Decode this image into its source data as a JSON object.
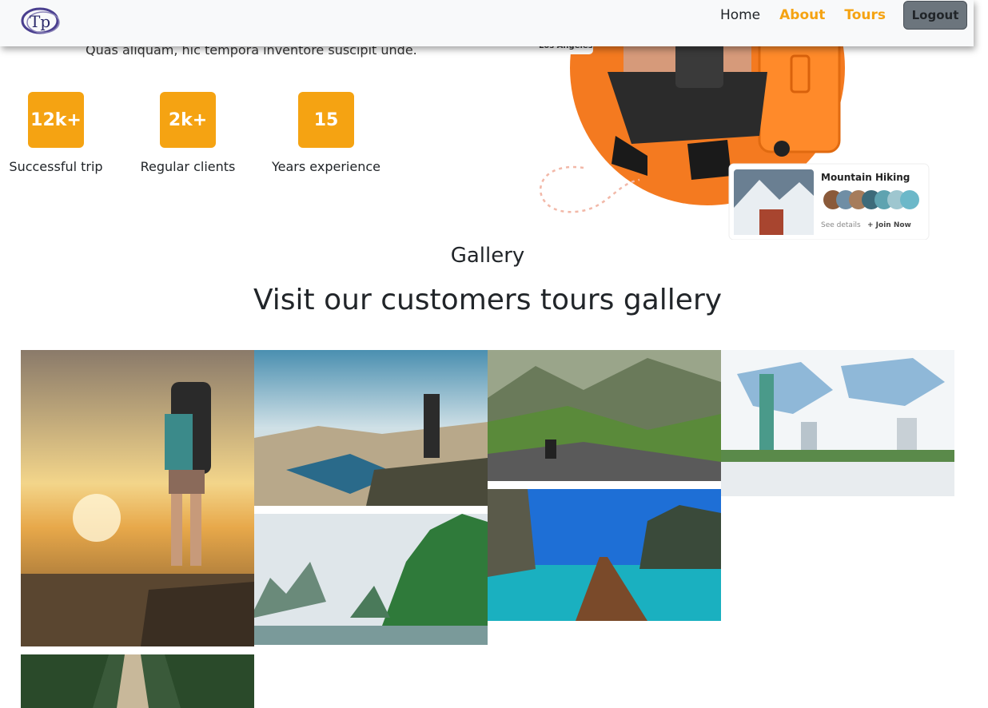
{
  "nav": {
    "logo_text": "Tp",
    "links": [
      "Home",
      "About",
      "Tours"
    ],
    "logout_label": "Logout"
  },
  "hero": {
    "subtitle": "Quas aliquam, hic tempora inventore suscipit unde.",
    "stats": [
      {
        "value": "12k+",
        "label": "Successful trip"
      },
      {
        "value": "2k+",
        "label": "Regular clients"
      },
      {
        "value": "15",
        "label": "Years experience"
      }
    ],
    "card": {
      "title": "Mountain Hiking",
      "details": "See details",
      "join": "+ Join Now",
      "location": "Los Angeles"
    }
  },
  "gallery": {
    "subtitle": "Gallery",
    "title": "Visit our customers tours gallery",
    "images": [
      "hiker-sunset-image",
      "photographer-lake-image",
      "mountain-valley-image",
      "statue-of-liberty-world-image",
      "karst-river-image",
      "longtail-boat-image",
      "rope-bridge-image"
    ]
  },
  "colors": {
    "accent": "#f5a312",
    "navbar_bg": "#f8f9fa",
    "logout_bg": "#6c757d"
  }
}
